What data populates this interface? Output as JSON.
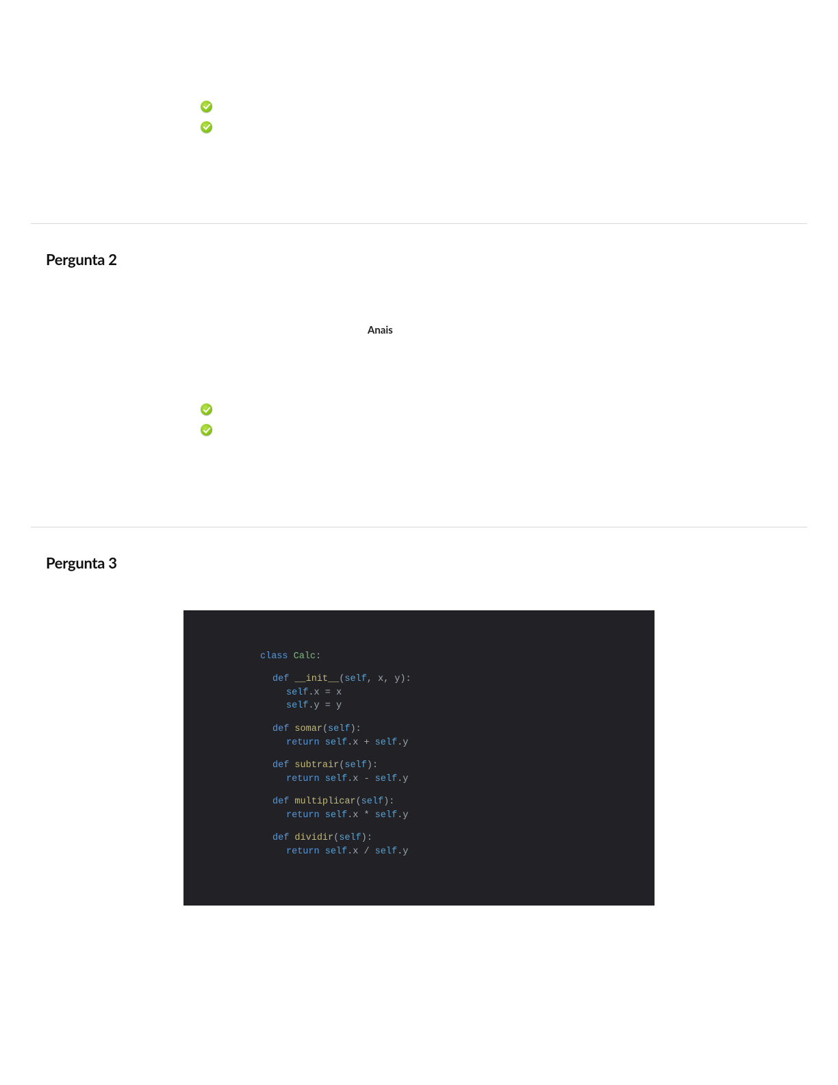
{
  "q1_area": {
    "answers": [
      {
        "correct": false,
        "text": ""
      },
      {
        "correct": false,
        "text": ""
      },
      {
        "correct": true,
        "text": ""
      },
      {
        "correct": true,
        "text": ""
      },
      {
        "correct": false,
        "text": ""
      }
    ]
  },
  "q2": {
    "heading": "Pergunta 2",
    "body_intro": "",
    "ref_prefix": "",
    "ref_author": "",
    "ref_mid": "",
    "ref_proceedings": "Anais",
    "ref_rest": "",
    "after": "",
    "answers": [
      {
        "correct": false,
        "text": ""
      },
      {
        "correct": false,
        "text": ""
      },
      {
        "correct": true,
        "text": ""
      },
      {
        "correct": true,
        "text": ""
      },
      {
        "correct": false,
        "text": ""
      }
    ],
    "resposta_label": "",
    "resposta_value": ""
  },
  "q3": {
    "heading": "Pergunta 3",
    "intro": "",
    "code": {
      "class_kw": "class",
      "class_name": "Calc",
      "def_kw": "def",
      "return_kw": "return",
      "self_kw": "self",
      "init": "__init__",
      "methods": [
        {
          "name": "somar",
          "op": "+"
        },
        {
          "name": "subtrair",
          "op": "-"
        },
        {
          "name": "multiplicar",
          "op": "*"
        },
        {
          "name": "dividir",
          "op": "/"
        }
      ],
      "x": "x",
      "y": "y"
    }
  }
}
